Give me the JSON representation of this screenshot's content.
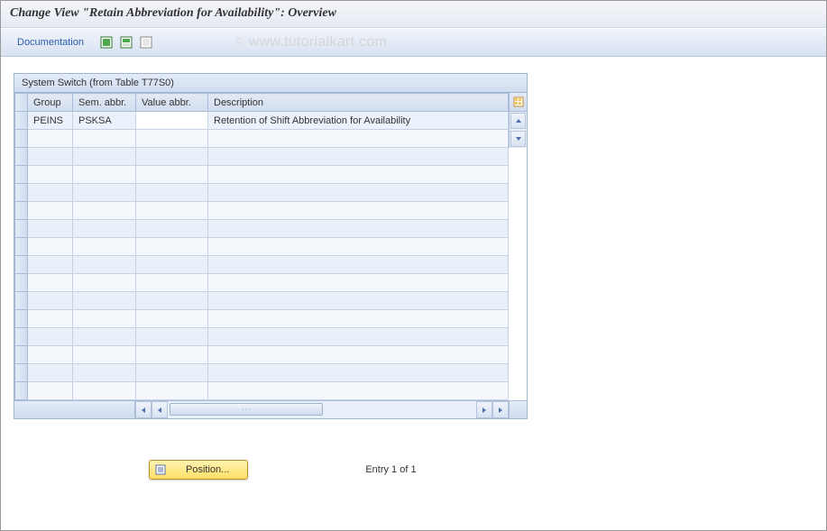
{
  "title": "Change View \"Retain Abbreviation for Availability\": Overview",
  "watermark": "www.tutorialkart.com",
  "toolbar": {
    "documentation_label": "Documentation"
  },
  "panel": {
    "title": "System Switch (from Table T77S0)"
  },
  "columns": {
    "group": "Group",
    "sem_abbr": "Sem. abbr.",
    "value_abbr": "Value abbr.",
    "description": "Description"
  },
  "rows": [
    {
      "group": "PEINS",
      "sem_abbr": "PSKSA",
      "value_abbr": "",
      "description": "Retention of Shift Abbreviation for Availability"
    }
  ],
  "footer": {
    "position_label": "Position...",
    "entry_text": "Entry 1 of 1"
  }
}
